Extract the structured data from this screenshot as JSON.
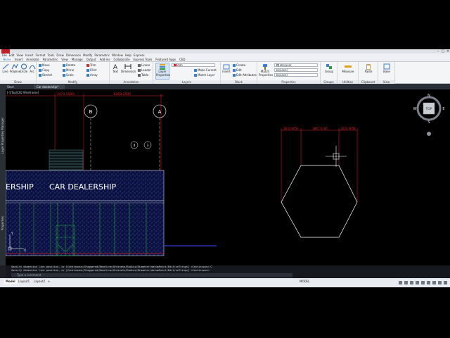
{
  "window": {
    "title_bar_buttons": [
      "–",
      "□",
      "×"
    ]
  },
  "menu": [
    "File",
    "Edit",
    "View",
    "Insert",
    "Format",
    "Tools",
    "Draw",
    "Dimension",
    "Modify",
    "Parametric",
    "Window",
    "Help",
    "Express"
  ],
  "ribbon_tabs": [
    "Home",
    "Insert",
    "Annotate",
    "Parametric",
    "View",
    "Manage",
    "Output",
    "Add-ins",
    "Collaborate",
    "Express Tools",
    "Featured Apps",
    "CED"
  ],
  "ribbon": {
    "draw": {
      "title": "Draw",
      "line": "Line",
      "polyline": "Polyline",
      "circle": "Circle",
      "arc": "Arc"
    },
    "modify": {
      "title": "Modify",
      "move": "Move",
      "rotate": "Rotate",
      "trim": "Trim",
      "copy": "Copy",
      "mirror": "Mirror",
      "fillet": "Fillet",
      "stretch": "Stretch",
      "scale": "Scale",
      "array": "Array"
    },
    "annotation": {
      "title": "Annotation",
      "text": "Text",
      "dimension": "Dimension",
      "linear": "Linear",
      "leader": "Leader",
      "table": "Table"
    },
    "layers": {
      "title": "Layers",
      "layer_properties": "Layer Properties",
      "current_layer": "dim",
      "make_current": "Make Current",
      "match_layer": "Match Layer"
    },
    "block": {
      "title": "Block",
      "insert": "Insert",
      "create": "Create",
      "edit": "Edit",
      "edit_attributes": "Edit Attributes"
    },
    "properties": {
      "title": "Properties",
      "match_properties": "Match Properties",
      "color": "ByLayer",
      "lineweight": "ByLayer",
      "linetype": "ByLayer"
    },
    "groups": {
      "title": "Groups",
      "group": "Group"
    },
    "utilities": {
      "title": "Utilities",
      "measure": "Measure"
    },
    "clipboard": {
      "title": "Clipboard",
      "paste": "Paste"
    },
    "view": {
      "title": "View",
      "base": "Base"
    }
  },
  "document_tabs": [
    "Start",
    "Car dealership*"
  ],
  "viewport": {
    "label": "[-][Top][2D Wireframe]",
    "viewcube": {
      "top": "TOP",
      "n": "N",
      "s": "S",
      "e": "E",
      "w": "W"
    }
  },
  "left_panels": [
    "Layer Properties Manager",
    "Properties"
  ],
  "drawing": {
    "dim_left": "3473.5000",
    "dim_right": "6209.2500",
    "grid_b": "B",
    "grid_a": "A",
    "marker_1": "4",
    "marker_2": "3",
    "sign_text_1": "ERSHIP",
    "sign_text_2": "CAR DEALERSHIP",
    "hex_dim_1": "2633.0654",
    "hex_dim_2": "3867.6300",
    "hex_dim_3": "2633.0654",
    "ucs_y": "Y",
    "ucs_x": "X"
  },
  "command": {
    "history_1": "Specify dimension line position, or [Continuous/Staggered/Baseline/Ordinate/Radius/Diameter/datumPoint/Edit/seTtings] <Continuous>:C",
    "history_2": "Specify dimension line position, or [Continuous/Staggered/Baseline/Ordinate/Radius/Diameter/datumPoint/Edit/seTtings] <Continuous>:",
    "placeholder": "Type a command"
  },
  "status": {
    "tabs": [
      "Model",
      "Layout1",
      "Layout2"
    ],
    "add": "+",
    "space": "MODEL"
  },
  "colors": {
    "accent": "#1d5fb4",
    "dimension": "#e0202a",
    "hatch_blue": "#1f2a8a",
    "green": "#1fa83a",
    "white_lines": "#ffffff"
  }
}
